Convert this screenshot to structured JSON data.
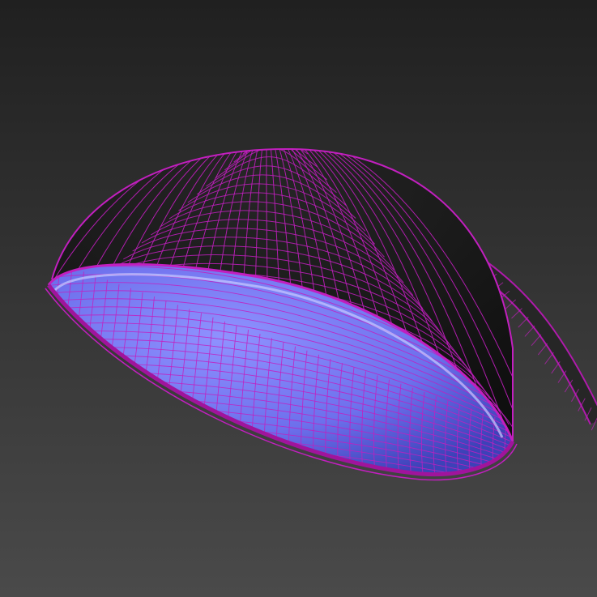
{
  "scene": {
    "object": "lamp-shade-wireframe",
    "background_top_color": "#202020",
    "background_bottom_color": "#4a4a4a",
    "wireframe_color": "#c21fbf",
    "rim_color": "#a0149c",
    "outer_shell_color": "#161616",
    "inner_shell_light_color": "#8a8cff",
    "inner_shell_dark_color": "#4a4fc8",
    "arm_color": "#2a2a2a"
  }
}
